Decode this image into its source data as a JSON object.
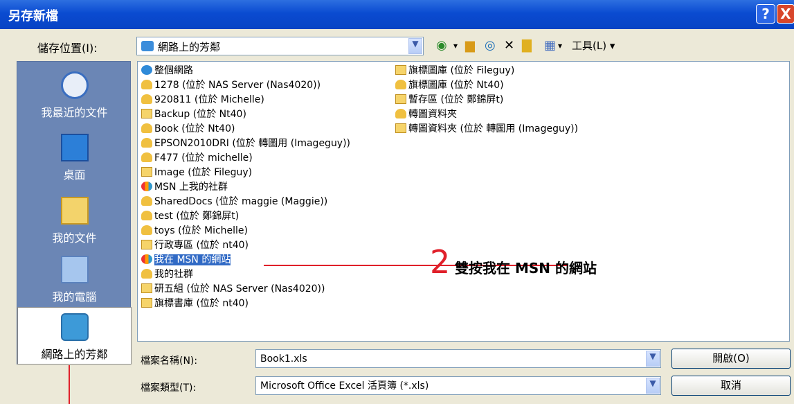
{
  "window": {
    "title": "另存新檔",
    "help_label": "?",
    "close_label": "X"
  },
  "save_in": {
    "label": "儲存位置(I):",
    "value": "網路上的芳鄰"
  },
  "toolbar": {
    "tools_label": "工具(L)"
  },
  "places": [
    {
      "label": "我最近的文件",
      "icon": "recent-documents-icon"
    },
    {
      "label": "桌面",
      "icon": "desktop-icon"
    },
    {
      "label": "我的文件",
      "icon": "my-documents-icon"
    },
    {
      "label": "我的電腦",
      "icon": "my-computer-icon"
    },
    {
      "label": "網路上的芳鄰",
      "icon": "network-places-icon",
      "selected": true
    }
  ],
  "items_col1": [
    {
      "label": "整個網路",
      "icon": "entire-network-icon"
    },
    {
      "label": "1278 (位於 NAS Server (Nas4020))",
      "icon": "share-icon"
    },
    {
      "label": "920811 (位於 Michelle)",
      "icon": "share-icon"
    },
    {
      "label": "Backup (位於 Nt40)",
      "icon": "folder-icon"
    },
    {
      "label": "Book (位於 Nt40)",
      "icon": "share-icon"
    },
    {
      "label": "EPSON2010DRI (位於 轉圖用 (Imageguy))",
      "icon": "share-icon"
    },
    {
      "label": "F477 (位於 michelle)",
      "icon": "share-icon"
    },
    {
      "label": "Image (位於 Fileguy)",
      "icon": "folder-icon"
    },
    {
      "label": "MSN 上我的社群",
      "icon": "msn-icon"
    },
    {
      "label": "SharedDocs (位於 maggie (Maggie))",
      "icon": "share-icon"
    },
    {
      "label": "test (位於 鄭錦屏t)",
      "icon": "share-icon"
    },
    {
      "label": "toys (位於 Michelle)",
      "icon": "share-icon"
    },
    {
      "label": "行政專區 (位於 nt40)",
      "icon": "folder-icon"
    },
    {
      "label": "我在 MSN 的網站",
      "icon": "msn-icon",
      "selected": true
    },
    {
      "label": "我的社群",
      "icon": "share-icon"
    },
    {
      "label": "研五組 (位於 NAS Server (Nas4020))",
      "icon": "folder-icon"
    },
    {
      "label": "旗標書庫 (位於 nt40)",
      "icon": "folder-icon"
    }
  ],
  "items_col2": [
    {
      "label": "旗標圖庫 (位於 Fileguy)",
      "icon": "folder-icon"
    },
    {
      "label": "旗標圖庫 (位於 Nt40)",
      "icon": "share-icon"
    },
    {
      "label": "暫存區 (位於 鄭錦屏t)",
      "icon": "folder-icon"
    },
    {
      "label": "轉圖資料夾",
      "icon": "share-icon"
    },
    {
      "label": "轉圖資料夾 (位於 轉圖用 (Imageguy))",
      "icon": "folder-icon"
    }
  ],
  "annotation": {
    "number": "2",
    "text": "雙按我在 MSN 的網站"
  },
  "filename": {
    "label": "檔案名稱(N):",
    "value": "Book1.xls"
  },
  "filetype": {
    "label": "檔案類型(T):",
    "value": "Microsoft Office Excel 活頁簿 (*.xls)"
  },
  "buttons": {
    "open": "開啟(O)",
    "cancel": "取消"
  },
  "colors": {
    "title_bar": "#0a4bd1",
    "places_bar": "#6b86b5",
    "selection": "#316ac5",
    "annotation": "#e0202a"
  }
}
